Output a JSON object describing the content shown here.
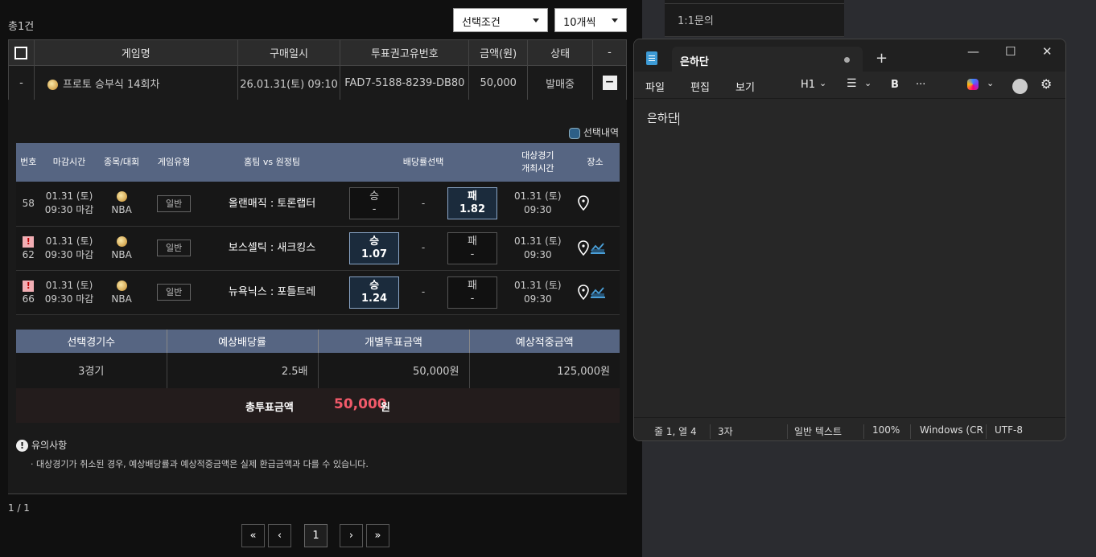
{
  "list": {
    "total_label": "총1건",
    "filter_select": "선택조건",
    "page_size_select": "10개씩"
  },
  "side_menu": {
    "inquiry": "1:1문의"
  },
  "main_table": {
    "headers": [
      "게임명",
      "구매일시",
      "투표권고유번호",
      "금액(원)",
      "상태",
      "-"
    ],
    "row": {
      "first": "-",
      "game": "프로토 승부식 14회차",
      "date": "26.01.31(토) 09:10",
      "ticket_id": "FAD7-5188-8239-DB80",
      "amount": "50,000",
      "status": "발매중",
      "toggle": "−"
    }
  },
  "detail": {
    "selection_legend": "선택내역",
    "headers": {
      "no": "번호",
      "deadline": "마감시간",
      "league": "종목/대회",
      "type": "게임유형",
      "teams": "홈팀 vs 원정팀",
      "odds": "배당률선택",
      "match_time_1": "대상경기",
      "match_time_2": "개최시간",
      "venue": "장소"
    },
    "rows": [
      {
        "no": "58",
        "warn": "",
        "date": "01.31 (토)",
        "deadline": "09:30 마감",
        "league": "NBA",
        "type": "일반",
        "teams": "올랜매직 : 토론랩터",
        "win_label": "승",
        "win_odds": "-",
        "draw": "-",
        "lose_label": "패",
        "lose_odds": "1.82",
        "match_date": "01.31 (토)",
        "match_time": "09:30"
      },
      {
        "no": "62",
        "warn": "!",
        "date": "01.31 (토)",
        "deadline": "09:30 마감",
        "league": "NBA",
        "type": "일반",
        "teams": "보스셀틱 : 새크킹스",
        "win_label": "승",
        "win_odds": "1.07",
        "draw": "-",
        "lose_label": "패",
        "lose_odds": "-",
        "match_date": "01.31 (토)",
        "match_time": "09:30"
      },
      {
        "no": "66",
        "warn": "!",
        "date": "01.31 (토)",
        "deadline": "09:30 마감",
        "league": "NBA",
        "type": "일반",
        "teams": "뉴욕닉스 : 포틀트레",
        "win_label": "승",
        "win_odds": "1.24",
        "draw": "-",
        "lose_label": "패",
        "lose_odds": "-",
        "match_date": "01.31 (토)",
        "match_time": "09:30"
      }
    ],
    "summary": {
      "headers": [
        "선택경기수",
        "예상배당률",
        "개별투표금액",
        "예상적중금액"
      ],
      "values": [
        "3경기",
        "2.5배",
        "50,000원",
        "125,000원"
      ]
    },
    "total": {
      "label": "총투표금액",
      "value": "50,000",
      "unit": "원"
    },
    "notice": {
      "title": "유의사항",
      "icon": "!",
      "text": "· 대상경기가 취소된 경우, 예상배당률과 예상적중금액은 실제 환급금액과 다를 수 있습니다."
    }
  },
  "pager": {
    "text": "1 / 1",
    "first": "«",
    "prev": "‹",
    "current": "1",
    "next": "›",
    "last": "»"
  },
  "notepad": {
    "tab_title": "은하단",
    "plus": "+",
    "minimize": "—",
    "maximize": "☐",
    "close": "✕",
    "menu": {
      "file": "파일",
      "edit": "편집",
      "view": "보기",
      "heading": "H1",
      "bold": "B",
      "more": "···"
    },
    "content": "은하단",
    "status": {
      "position": "줄 1, 열 4",
      "chars": "3자",
      "format": "일반 텍스트",
      "zoom": "100%",
      "eol": "Windows (CR",
      "encoding": "UTF-8"
    }
  }
}
